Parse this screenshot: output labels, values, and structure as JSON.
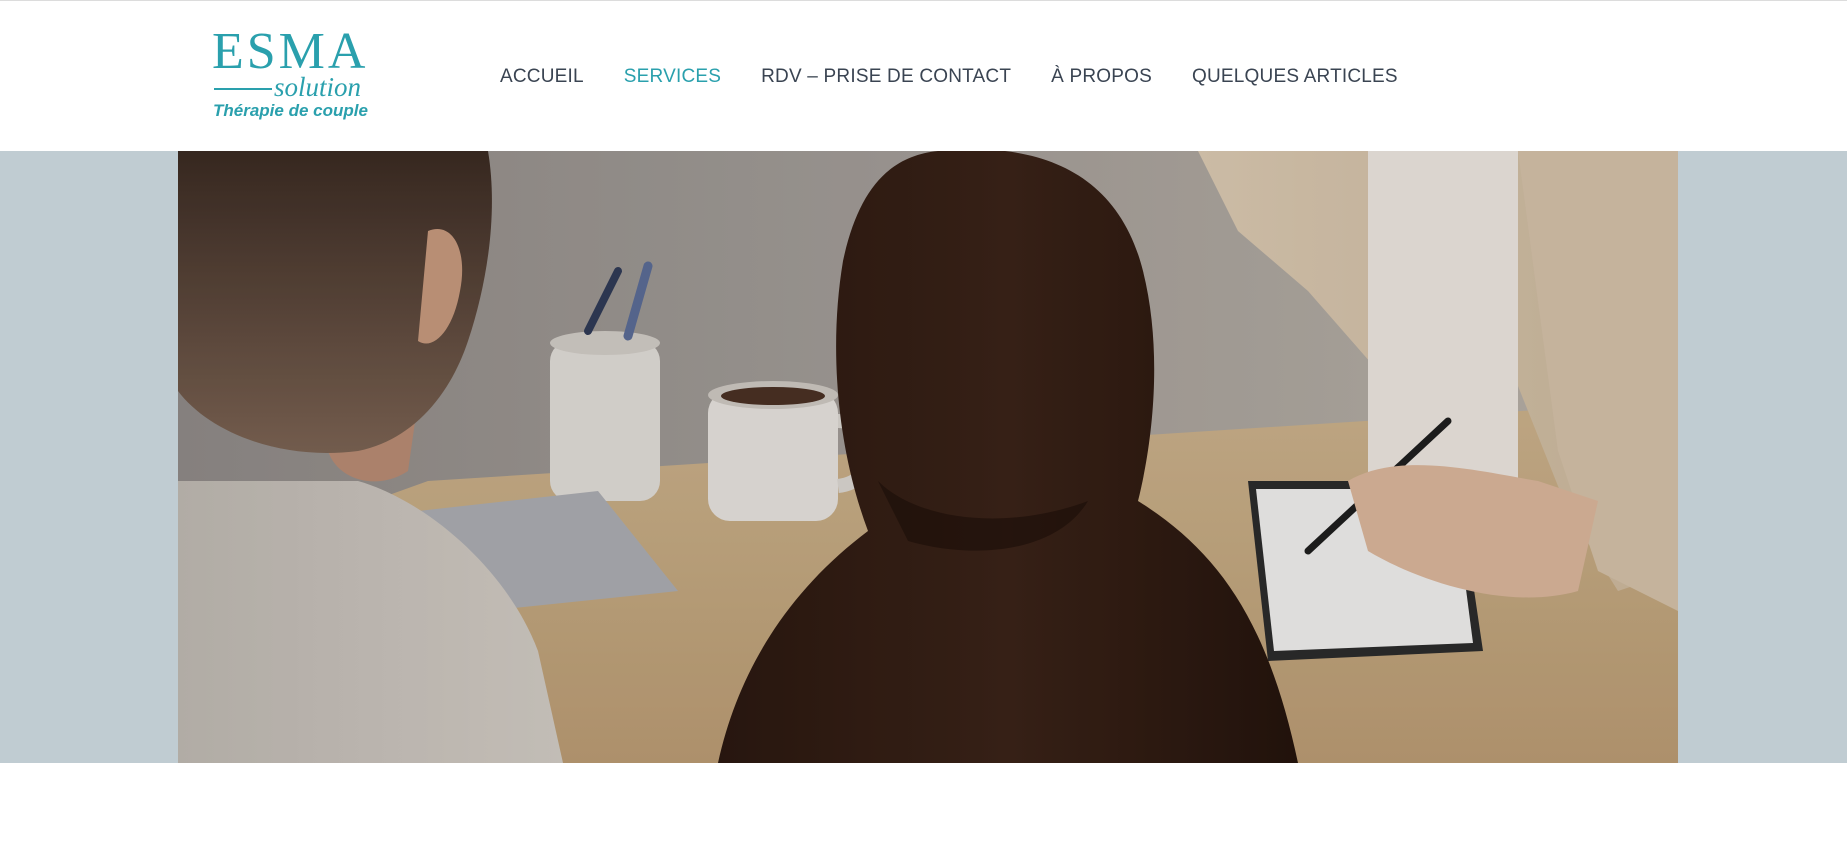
{
  "logo": {
    "main": "ESMA",
    "sub": "solution",
    "tagline": "Thérapie de couple"
  },
  "nav": {
    "items": [
      {
        "label": "ACCUEIL",
        "active": false
      },
      {
        "label": "SERVICES",
        "active": true
      },
      {
        "label": "RDV – PRISE DE CONTACT",
        "active": false
      },
      {
        "label": "À PROPOS",
        "active": false
      },
      {
        "label": "QUELQUES ARTICLES",
        "active": false
      }
    ]
  },
  "colors": {
    "accent": "#2aa0ad",
    "nav_text": "#3a4452",
    "hero_band": "#c0ccd2"
  }
}
